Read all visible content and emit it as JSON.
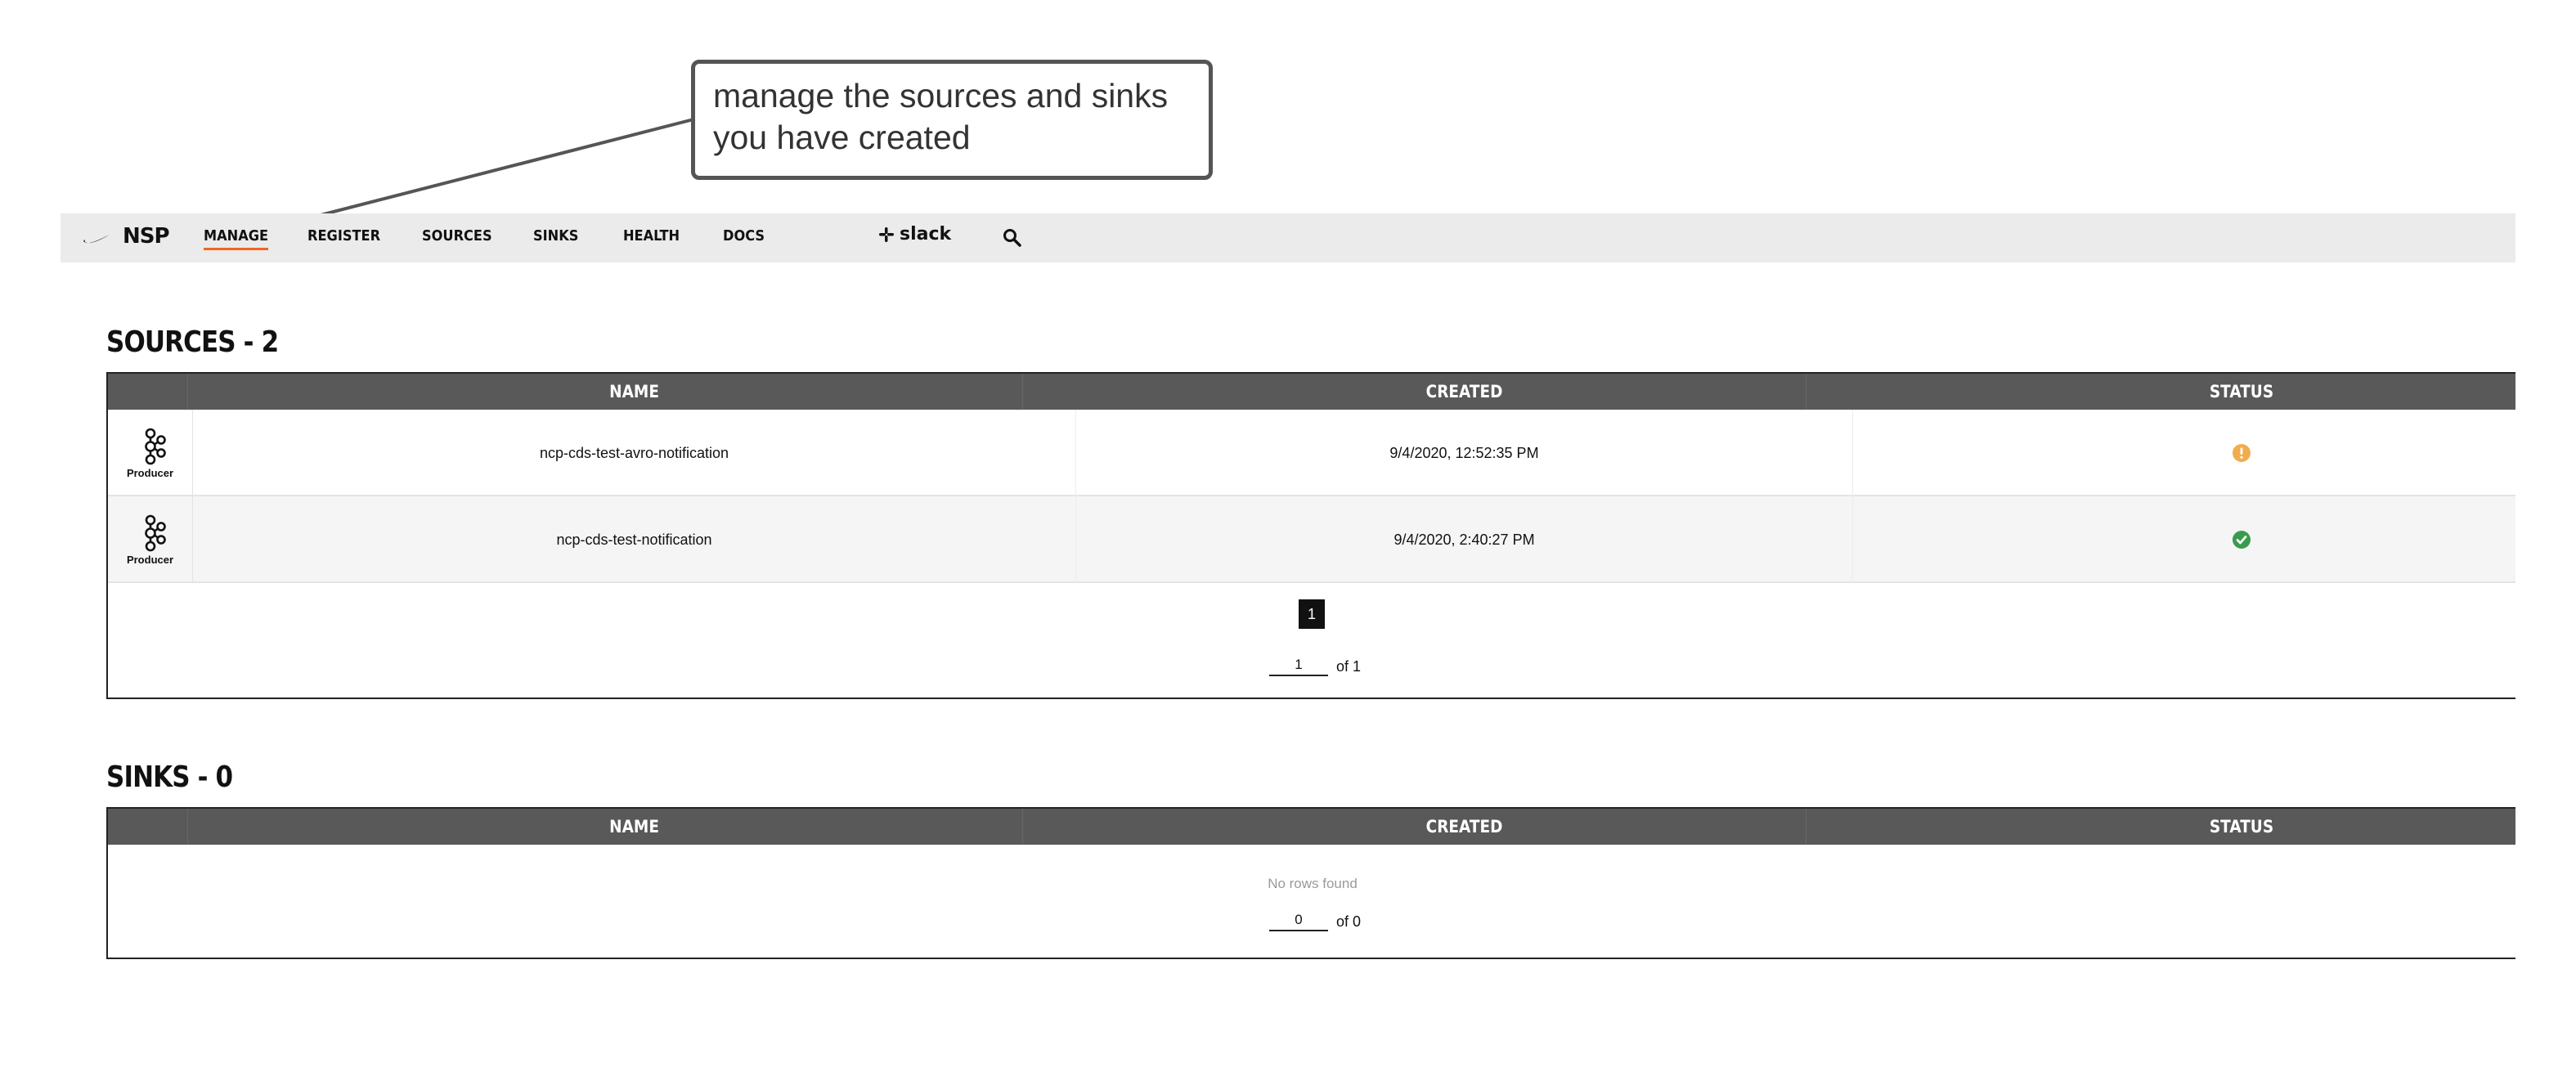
{
  "callout": {
    "text": "manage the sources and sinks you have created"
  },
  "nav": {
    "brand": "NSP",
    "items": [
      {
        "label": "MANAGE",
        "active": true
      },
      {
        "label": "REGISTER",
        "active": false
      },
      {
        "label": "SOURCES",
        "active": false
      },
      {
        "label": "SINKS",
        "active": false
      },
      {
        "label": "HEALTH",
        "active": false
      },
      {
        "label": "DOCS",
        "active": false
      }
    ],
    "slack_label": "slack",
    "search_icon": "search-icon",
    "active_color": "#f26522"
  },
  "sources": {
    "title": "SOURCES - 2",
    "columns": {
      "name": "NAME",
      "created": "CREATED",
      "status": "STATUS"
    },
    "rows": [
      {
        "type": "Producer",
        "name": "ncp-cds-test-avro-notification",
        "created": "9/4/2020, 12:52:35 PM",
        "status": "warning",
        "status_color": "#f0ad4e"
      },
      {
        "type": "Producer",
        "name": "ncp-cds-test-notification",
        "created": "9/4/2020, 2:40:27 PM",
        "status": "ok",
        "status_color": "#3a9b4f"
      }
    ],
    "pagination": {
      "current_page": "1",
      "page_input": "1",
      "of_label": "of 1"
    }
  },
  "sinks": {
    "title": "SINKS - 0",
    "columns": {
      "name": "NAME",
      "created": "CREATED",
      "status": "STATUS"
    },
    "empty_text": "No rows found",
    "pagination": {
      "page_input": "0",
      "of_label": "of 0"
    }
  }
}
